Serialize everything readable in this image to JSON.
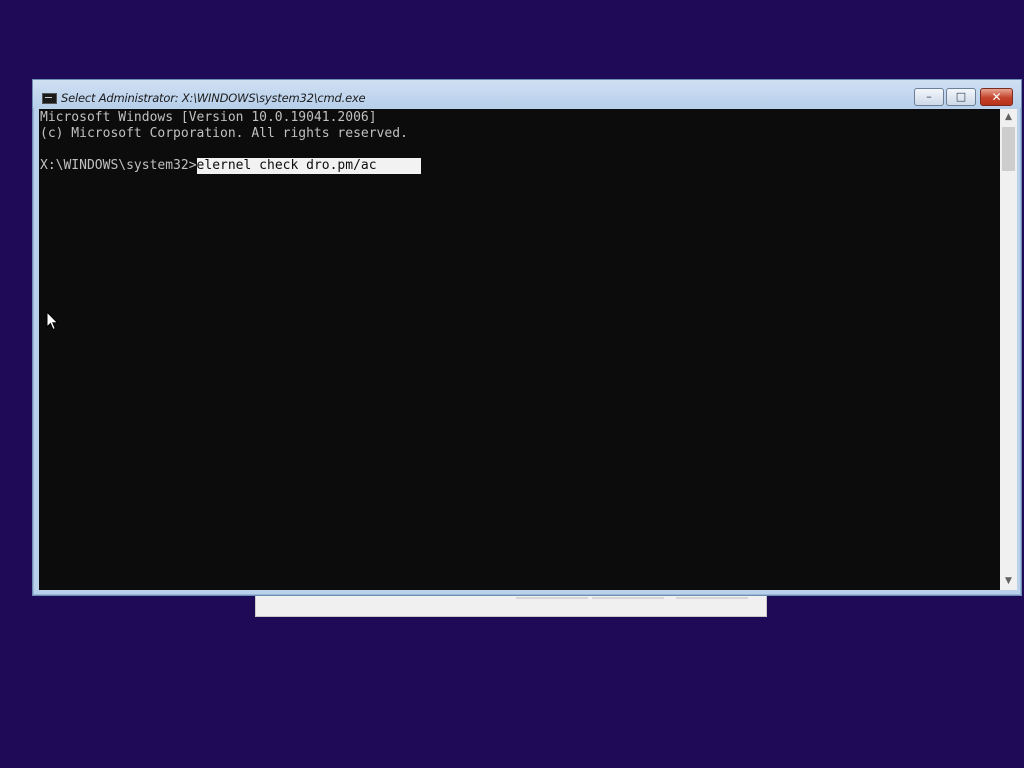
{
  "window": {
    "title": "Select Administrator: X:\\WINDOWS\\system32\\cmd.exe",
    "minimize_glyph": "–",
    "maximize_glyph": "□",
    "close_glyph": "✕"
  },
  "console": {
    "lines": [
      "Microsoft Windows [Version 10.0.19041.2006]",
      "(c) Microsoft Corporation. All rights reserved."
    ],
    "prompt": "X:\\WINDOWS\\system32>",
    "command": "elernel check dro.pm/ac",
    "text_color": "#c0c0c0",
    "background_color": "#0c0c0c"
  },
  "scrollbar": {
    "up_glyph": "▲",
    "down_glyph": "▼"
  },
  "colors": {
    "desktop_background": "#1e0a57",
    "title_bar": "#b9d1ea",
    "close_button": "#c4432a"
  },
  "icons": {
    "title_icon": "cmd-icon",
    "pointer": "mouse-pointer-icon"
  }
}
